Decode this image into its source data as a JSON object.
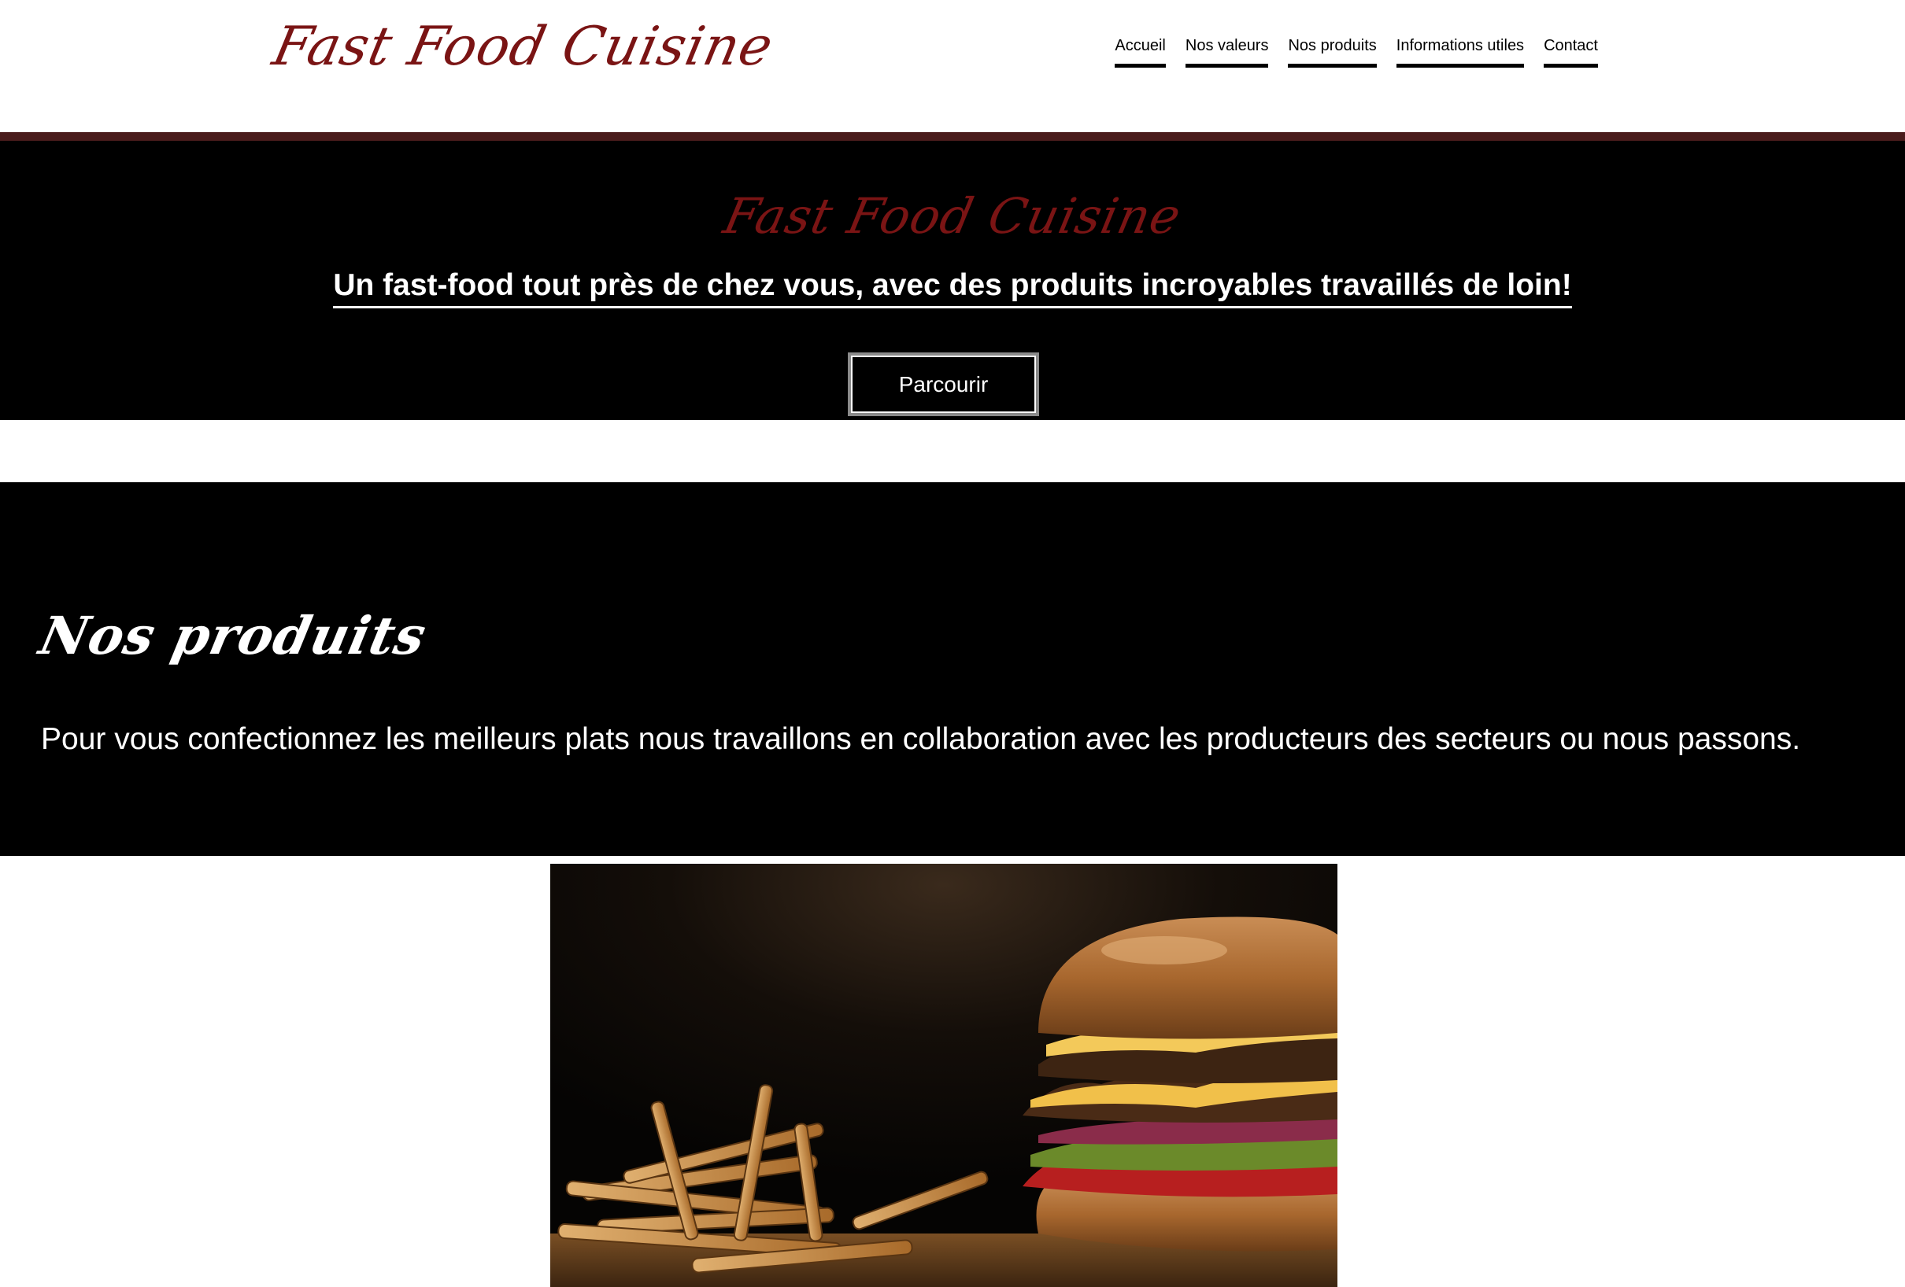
{
  "header": {
    "logo": "Fast Food Cuisine",
    "nav": [
      {
        "label": "Accueil"
      },
      {
        "label": "Nos valeurs"
      },
      {
        "label": "Nos produits"
      },
      {
        "label": "Informations utiles"
      },
      {
        "label": "Contact"
      }
    ]
  },
  "hero": {
    "logo": "Fast Food Cuisine",
    "tagline": "Un fast-food tout près de chez vous, avec des produits incroyables travaillés de loin!",
    "button_label": "Parcourir"
  },
  "products": {
    "title": "Nos produits",
    "text": "Pour vous confectionnez les meilleurs plats nous travaillons en collaboration avec les producteurs des secteurs ou nous passons."
  },
  "image": {
    "subject": "burger-and-fries-photo"
  },
  "colors": {
    "brand": "#7a1414",
    "divider": "#4a1c1c",
    "section_bg": "#000000"
  }
}
